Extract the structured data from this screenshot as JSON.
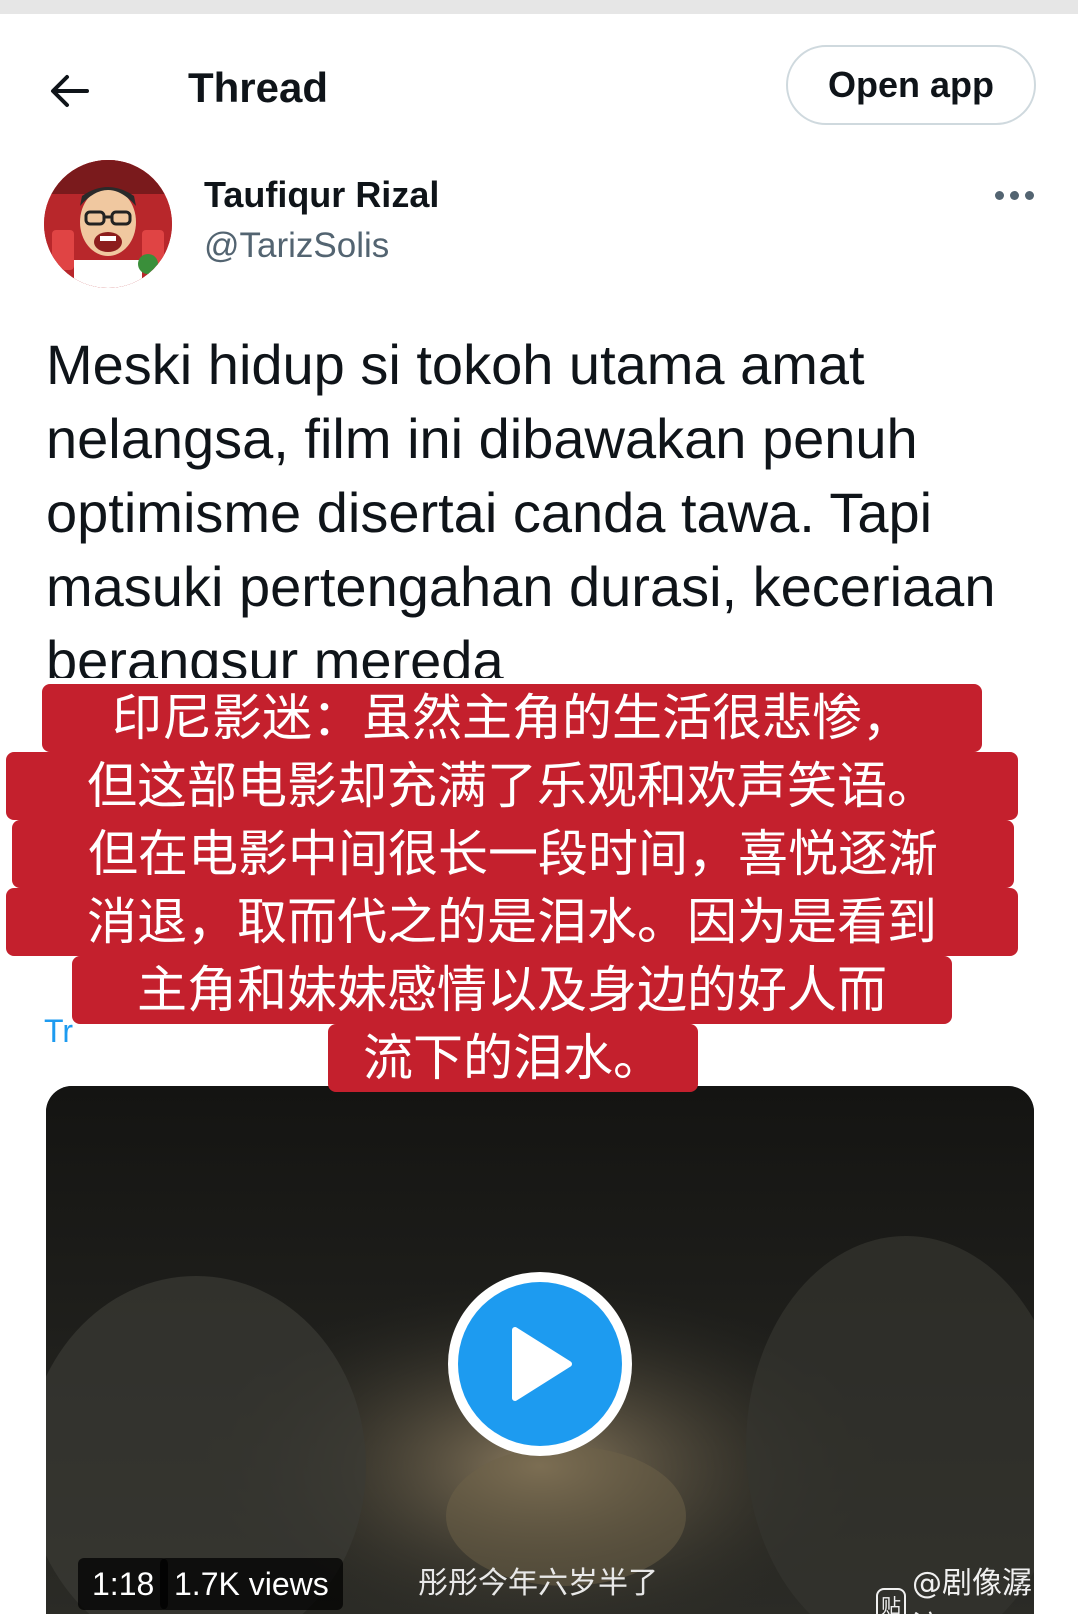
{
  "header": {
    "title": "Thread",
    "open_app_label": "Open app"
  },
  "author": {
    "name": "Taufiqur Rizal",
    "handle": "@TarizSolis"
  },
  "tweet": {
    "text": "Meski hidup si tokoh utama amat nelangsa, film ini dibawakan penuh optimisme disertai canda tawa. Tapi masuki pertengahan durasi, keceriaan berangsur mereda",
    "translate_partial": "Tr"
  },
  "subtitle_overlay": {
    "lines": [
      "印尼影迷：虽然主角的生活很悲惨，",
      "但这部电影却充满了乐观和欢声笑语。",
      "但在电影中间很长一段时间，喜悦逐渐",
      "消退，取而代之的是泪水。因为是看到",
      "主角和妹妹感情以及身边的好人而",
      "流下的泪水。"
    ]
  },
  "video": {
    "duration": "1:18",
    "views": "1.7K views",
    "caption": "彤彤今年六岁半了",
    "watermark_logo": "贴",
    "watermark_text": "@剧像潺流"
  },
  "colors": {
    "accent": "#1d9bf0",
    "subtitle_bg": "#c4202d",
    "text_primary": "#0f1419",
    "text_secondary": "#536471"
  }
}
